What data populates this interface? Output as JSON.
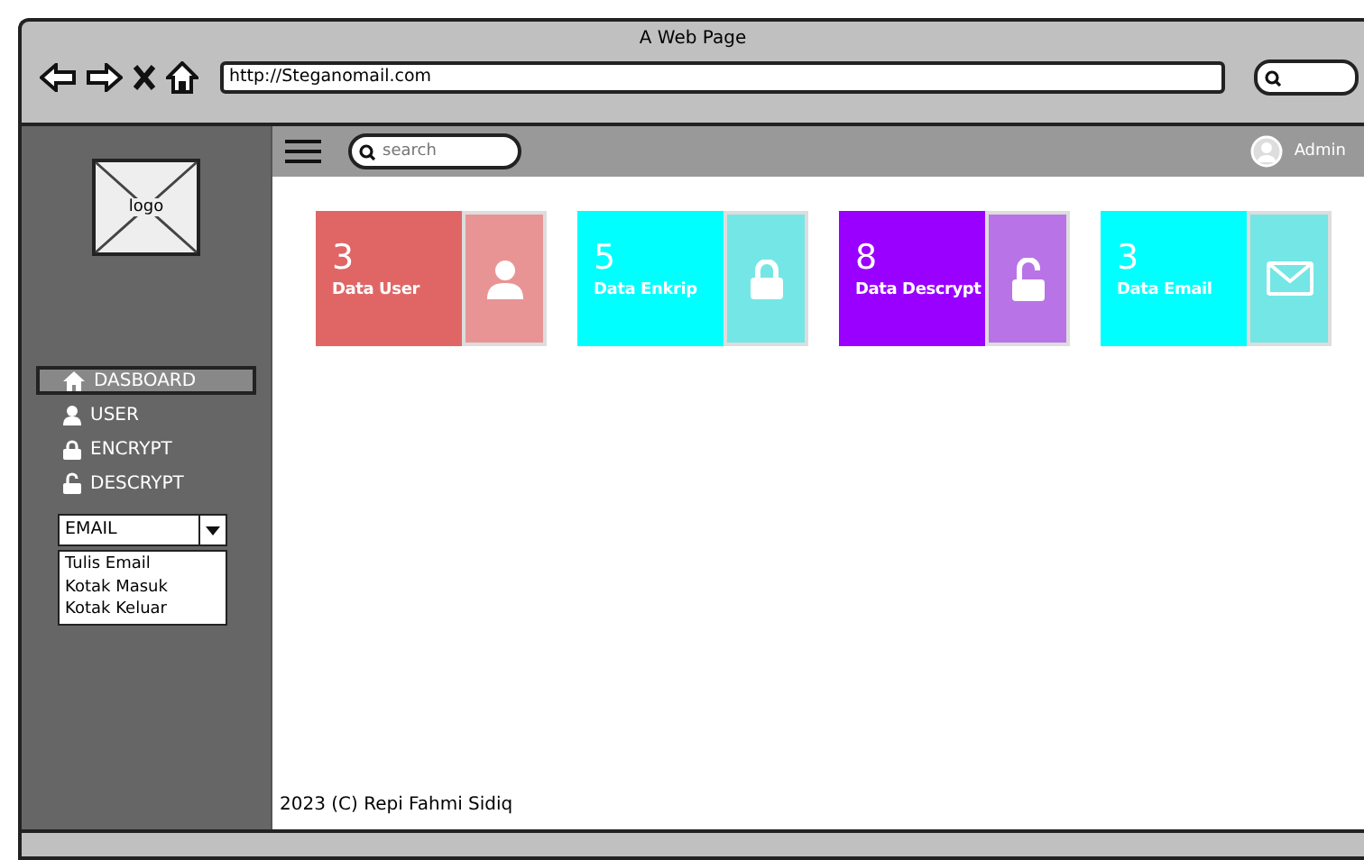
{
  "window": {
    "title": "A Web Page",
    "url": "http://Steganomail.com"
  },
  "topbar": {
    "search_placeholder": "search",
    "user": "Admin"
  },
  "sidebar": {
    "logo": "logo",
    "items": [
      {
        "label": "DASBOARD",
        "selected": true
      },
      {
        "label": "USER",
        "selected": false
      },
      {
        "label": "ENCRYPT",
        "selected": false
      },
      {
        "label": "DESCRYPT",
        "selected": false
      }
    ],
    "dropdown": {
      "value": "EMAIL",
      "expanded": true,
      "options": [
        "Tulis Email",
        "Kotak Masuk",
        "Kotak Keluar"
      ]
    }
  },
  "cards": [
    {
      "count": "3",
      "label": "Data User",
      "color": "#e06666"
    },
    {
      "count": "5",
      "label": "Data Enkrip",
      "color": "#00ffff"
    },
    {
      "count": "8",
      "label": "Data Descrypt",
      "color": "#9900ff"
    },
    {
      "count": "3",
      "label": "Data Email",
      "color": "#00ffff"
    }
  ],
  "footer": "2023 (C) Repi Fahmi Sidiq"
}
